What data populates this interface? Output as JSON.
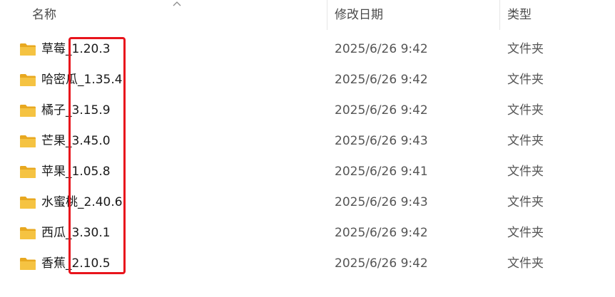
{
  "columns": {
    "name": "名称",
    "date_modified": "修改日期",
    "type": "类型"
  },
  "sort": {
    "column": "name",
    "direction": "ascending",
    "icon": "chevron-up-icon"
  },
  "rows": [
    {
      "name": "草莓_1.20.3",
      "date": "2025/6/26 9:42",
      "type": "文件夹",
      "icon": "folder-icon"
    },
    {
      "name": "哈密瓜_1.35.4",
      "date": "2025/6/26 9:42",
      "type": "文件夹",
      "icon": "folder-icon"
    },
    {
      "name": "橘子_3.15.9",
      "date": "2025/6/26 9:42",
      "type": "文件夹",
      "icon": "folder-icon"
    },
    {
      "name": "芒果_3.45.0",
      "date": "2025/6/26 9:43",
      "type": "文件夹",
      "icon": "folder-icon"
    },
    {
      "name": "苹果_1.05.8",
      "date": "2025/6/26 9:41",
      "type": "文件夹",
      "icon": "folder-icon"
    },
    {
      "name": "水蜜桃_2.40.6",
      "date": "2025/6/26 9:43",
      "type": "文件夹",
      "icon": "folder-icon"
    },
    {
      "name": "西瓜_3.30.1",
      "date": "2025/6/26 9:42",
      "type": "文件夹",
      "icon": "folder-icon"
    },
    {
      "name": "香蕉_2.10.5",
      "date": "2025/6/26 9:42",
      "type": "文件夹",
      "icon": "folder-icon"
    }
  ],
  "colors": {
    "highlight": "#e8141c",
    "folder": "#f5c342"
  }
}
